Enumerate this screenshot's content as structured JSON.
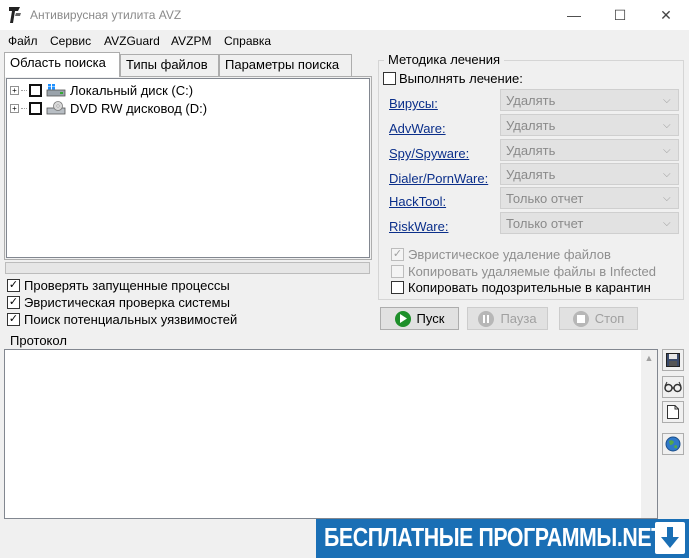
{
  "window": {
    "title": "Антивирусная утилита AVZ",
    "controls": {
      "minimize": "—",
      "maximize": "☐",
      "close": "✕"
    }
  },
  "menu": [
    "Файл",
    "Сервис",
    "AVZGuard",
    "AVZPM",
    "Справка"
  ],
  "tabs": [
    {
      "label": "Область поиска",
      "active": true
    },
    {
      "label": "Типы файлов",
      "active": false
    },
    {
      "label": "Параметры поиска",
      "active": false
    }
  ],
  "tree": {
    "items": [
      {
        "label": "Локальный диск (C:)",
        "checked": false
      },
      {
        "label": "DVD RW дисковод (D:)",
        "checked": false
      }
    ]
  },
  "progress": {
    "value": 0
  },
  "options": [
    {
      "label": "Проверять запущенные процессы",
      "checked": true
    },
    {
      "label": "Эвристическая проверка системы",
      "checked": true
    },
    {
      "label": "Поиск потенциальных уязвимостей",
      "checked": true
    }
  ],
  "treatment": {
    "title": "Методика лечения",
    "perform_label": "Выполнять лечение:",
    "perform_checked": false,
    "rows": [
      {
        "label": "Вирусы:",
        "value": "Удалять"
      },
      {
        "label": "AdvWare:",
        "value": "Удалять"
      },
      {
        "label": "Spy/Spyware:",
        "value": "Удалять"
      },
      {
        "label": "Dialer/PornWare:",
        "value": "Удалять"
      },
      {
        "label": "HackTool:",
        "value": "Только отчет"
      },
      {
        "label": "RiskWare:",
        "value": "Только отчет"
      }
    ],
    "extra": [
      {
        "label": "Эвристическое удаление файлов",
        "checked": true,
        "disabled": true
      },
      {
        "label": "Копировать удаляемые файлы в  Infected",
        "checked": false,
        "disabled": true
      },
      {
        "label": "Копировать подозрительные в  карантин",
        "checked": false,
        "disabled": false
      }
    ]
  },
  "buttons": {
    "start": "Пуск",
    "pause": "Пауза",
    "stop": "Стоп"
  },
  "protocol": {
    "label": "Протокол"
  },
  "colors": {
    "start_icon": "#1e8f2a",
    "link": "#0b2f8a",
    "banner": "#1a6fb5"
  },
  "banner": {
    "text": "БЕСПЛАТНЫЕ ПРОГРАММЫ.NET"
  }
}
